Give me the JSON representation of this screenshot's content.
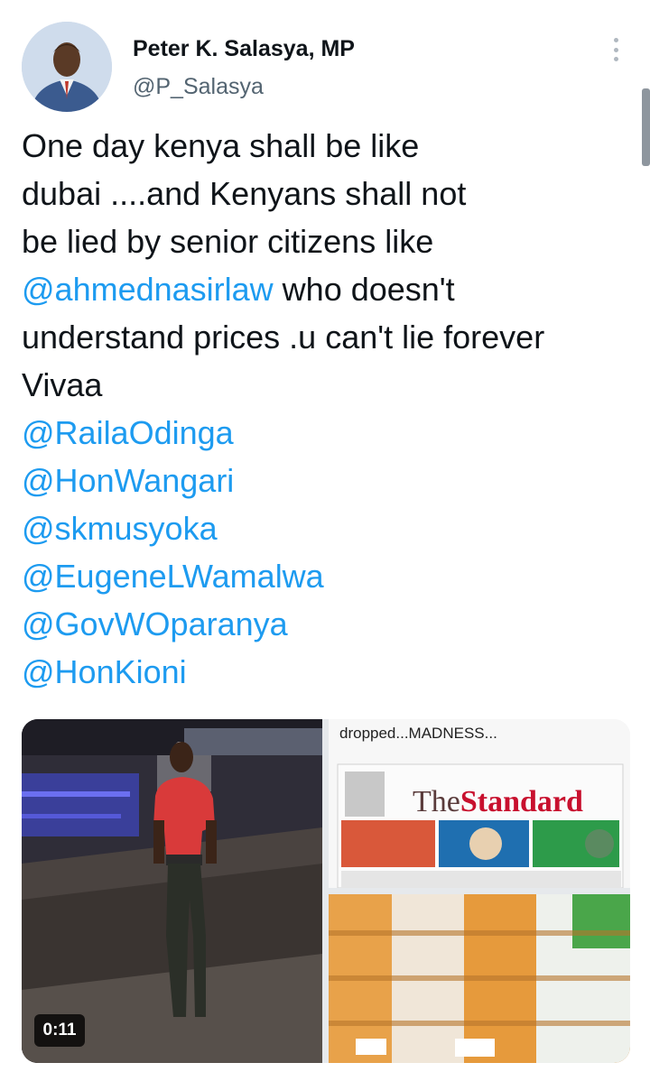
{
  "author": {
    "display_name": "Peter K. Salasya, MP",
    "handle": "@P_Salasya"
  },
  "tweet": {
    "lines": [
      [
        {
          "text": "One day kenya shall be like",
          "type": "text"
        }
      ],
      [
        {
          "text": "dubai ....and Kenyans shall not",
          "type": "text"
        }
      ],
      [
        {
          "text": "be lied by senior citizens like",
          "type": "text"
        }
      ],
      [
        {
          "text": "@ahmednasirlaw",
          "type": "mention"
        },
        {
          "text": " who doesn't",
          "type": "text"
        }
      ],
      [
        {
          "text": "understand prices .u can't lie forever",
          "type": "text"
        }
      ],
      [
        {
          "text": "Vivaa",
          "type": "text"
        }
      ],
      [
        {
          "text": "@RailaOdinga",
          "type": "mention"
        }
      ],
      [
        {
          "text": "@HonWangari",
          "type": "mention"
        }
      ],
      [
        {
          "text": "@skmusyoka",
          "type": "mention"
        }
      ],
      [
        {
          "text": "@EugeneLWamalwa",
          "type": "mention"
        }
      ],
      [
        {
          "text": "@GovWOparanya",
          "type": "mention"
        }
      ],
      [
        {
          "text": "@HonKioni",
          "type": "mention"
        }
      ]
    ]
  },
  "media": {
    "video_duration": "0:11",
    "newspaper_caption": "dropped...MADNESS...",
    "newspaper_title_the": "The",
    "newspaper_title_name": "Standard"
  },
  "icons": {
    "more": "more-vertical-icon"
  },
  "colors": {
    "mention": "#1d9bf0",
    "handle": "#536471",
    "text": "#0f1419"
  }
}
